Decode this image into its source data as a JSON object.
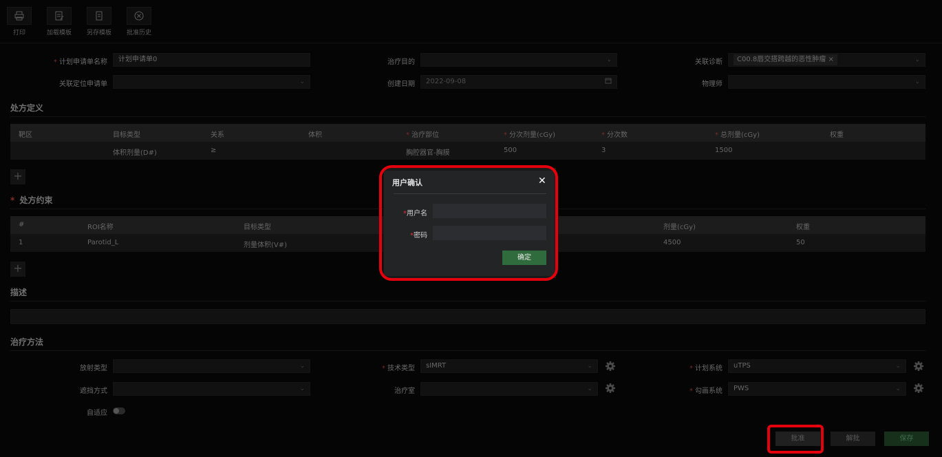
{
  "toolbar": {
    "print": "打印",
    "load_template": "加载模板",
    "save_template": "另存模板",
    "approval_history": "批准历史"
  },
  "form": {
    "plan_name_label": "计划申请单名称",
    "plan_name_value": "计划申请单0",
    "treatment_purpose_label": "治疗目的",
    "diagnosis_label": "关联诊断",
    "diagnosis_tag": "C00.8唇交搭跨越的恶性肿瘤",
    "related_app_label": "关联定位申请单",
    "create_date_label": "创建日期",
    "create_date_value": "2022-09-08",
    "physicist_label": "物理师"
  },
  "prescription": {
    "title": "处方定义",
    "headers": [
      "靶区",
      "目标类型",
      "关系",
      "体积",
      "治疗部位",
      "分次剂量(cGy)",
      "分次数",
      "总剂量(cGy)",
      "权重"
    ],
    "rows": [
      [
        "",
        "体积剂量(D#)",
        "≥",
        "",
        "胸腔器官-胸膜",
        "500",
        "3",
        "1500",
        ""
      ]
    ]
  },
  "constraints": {
    "title": "处方约束",
    "headers": [
      "#",
      "ROI名称",
      "目标类型",
      "剂量(cGy)",
      "权重"
    ],
    "rows": [
      [
        "1",
        "Parotid_L",
        "剂量体积(V#)",
        "4500",
        "50"
      ]
    ]
  },
  "description": {
    "title": "描述"
  },
  "treatment": {
    "title": "治疗方法",
    "radiation_type_label": "放射类型",
    "technique_label": "技术类型",
    "technique_value": "sIMRT",
    "planning_system_label": "计划系统",
    "planning_system_value": "uTPS",
    "shielding_label": "遮挡方式",
    "room_label": "治疗室",
    "contour_system_label": "勾画系统",
    "contour_system_value": "PWS",
    "adaptive_label": "自适应"
  },
  "buttons": {
    "approve": "批准",
    "unapprove": "解批",
    "save": "保存"
  },
  "modal": {
    "title": "用户确认",
    "username_label": "用户名",
    "password_label": "密码",
    "confirm": "确定"
  },
  "colors": {
    "highlight": "#e4000c",
    "confirm_button": "#2f6b3c"
  }
}
